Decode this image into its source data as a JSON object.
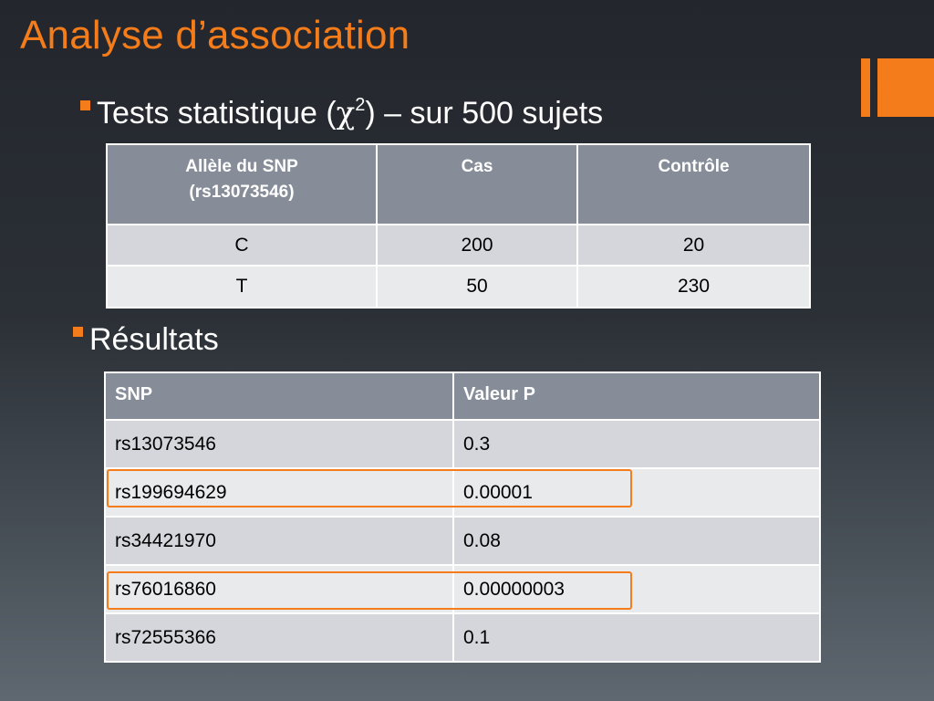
{
  "slide": {
    "title": "Analyse d’association",
    "accent_color": "#f47c1a"
  },
  "bullets": [
    {
      "text_prefix": "Tests statistique (",
      "chi": "χ",
      "sup": "2",
      "text_suffix": ") – sur 500 sujets"
    },
    {
      "text": "Résultats"
    }
  ],
  "table1": {
    "headers": [
      "Allèle du SNP",
      "(rs13073546)",
      "Cas",
      "Contrôle"
    ],
    "rows": [
      [
        "C",
        "200",
        "20"
      ],
      [
        "T",
        "50",
        "230"
      ]
    ]
  },
  "table2": {
    "headers": [
      "SNP",
      "Valeur P"
    ],
    "rows": [
      [
        "rs13073546",
        "0.3"
      ],
      [
        "rs199694629",
        "0.00001"
      ],
      [
        "rs34421970",
        "0.08"
      ],
      [
        "rs76016860",
        "0.00000003"
      ],
      [
        "rs72555366",
        "0.1"
      ]
    ]
  }
}
